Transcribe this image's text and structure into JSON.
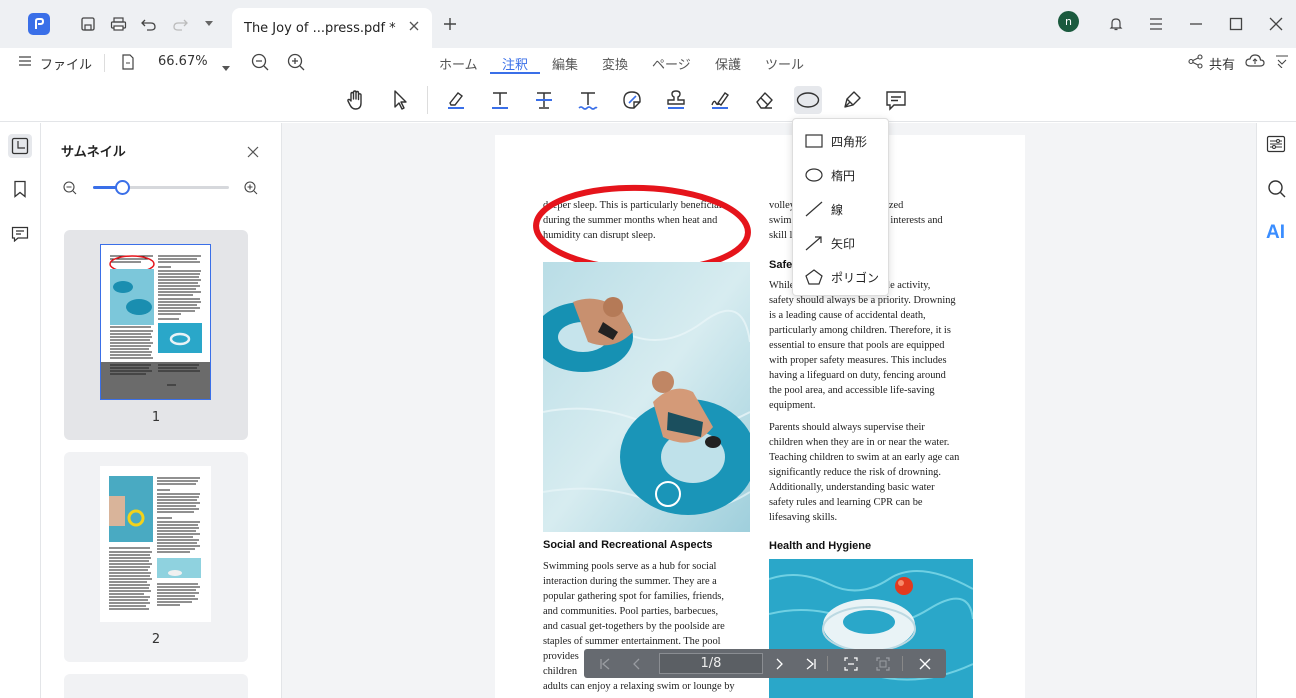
{
  "titlebar": {
    "tab_title": "The Joy of ...press.pdf *",
    "avatar_letter": "n"
  },
  "menubar": {
    "file_label": "ファイル",
    "zoom": "66.67%",
    "tabs": [
      "ホーム",
      "注釈",
      "編集",
      "変換",
      "ページ",
      "保護",
      "ツール"
    ],
    "active_tab": "注釈",
    "share_label": "共有"
  },
  "sidebar": {
    "title": "サムネイル",
    "pages": [
      "1",
      "2"
    ],
    "zoom_slider": 0.21
  },
  "shape_menu": {
    "items": [
      "四角形",
      "楕円",
      "線",
      "矢印",
      "ポリゴン"
    ]
  },
  "document": {
    "left_top_text": [
      "deeper sleep. This is particularly beneficial",
      "during the summer months when heat and",
      "humidity can disrupt sleep."
    ],
    "right_top_text": [
      "volley",
      "hronized",
      "swim",
      "erent interests and",
      "skill l"
    ],
    "safety_heading": "Safet",
    "safety_p1": [
      "While",
      "oyable activity,",
      "safety should always be a priority. Drowning",
      "is a leading cause of accidental death,",
      "particularly among children. Therefore, it is",
      "essential to ensure that pools are equipped",
      "with proper safety measures. This includes",
      "having a lifeguard on duty, fencing around",
      "the pool area, and accessible life-saving",
      "equipment."
    ],
    "safety_p2": [
      "Parents should always supervise their",
      "children when they are in or near the water.",
      "Teaching children to swim at an early age can",
      "significantly reduce the risk of drowning.",
      "Additionally, understanding basic water",
      "safety rules and learning CPR can be",
      "lifesaving skills."
    ],
    "social_heading": "Social and Recreational Aspects",
    "social_p": [
      "Swimming pools serve as a hub for social",
      "interaction during the summer. They are a",
      "popular gathering spot for families, friends,",
      "and communities. Pool parties, barbecues,",
      "and casual get-togethers by the poolside are",
      "staples of summer entertainment. The pool",
      "provides",
      "children",
      "adults can enjoy a relaxing swim or lounge by"
    ],
    "health_heading": "Health and Hygiene"
  },
  "bottom_nav": {
    "page_indicator": "1/8"
  },
  "right_rail": {
    "ai_label": "AI"
  },
  "colors": {
    "accent": "#3a6fe8",
    "annotation_red": "#e5141b",
    "pool_blue": "#2aa7c9"
  }
}
